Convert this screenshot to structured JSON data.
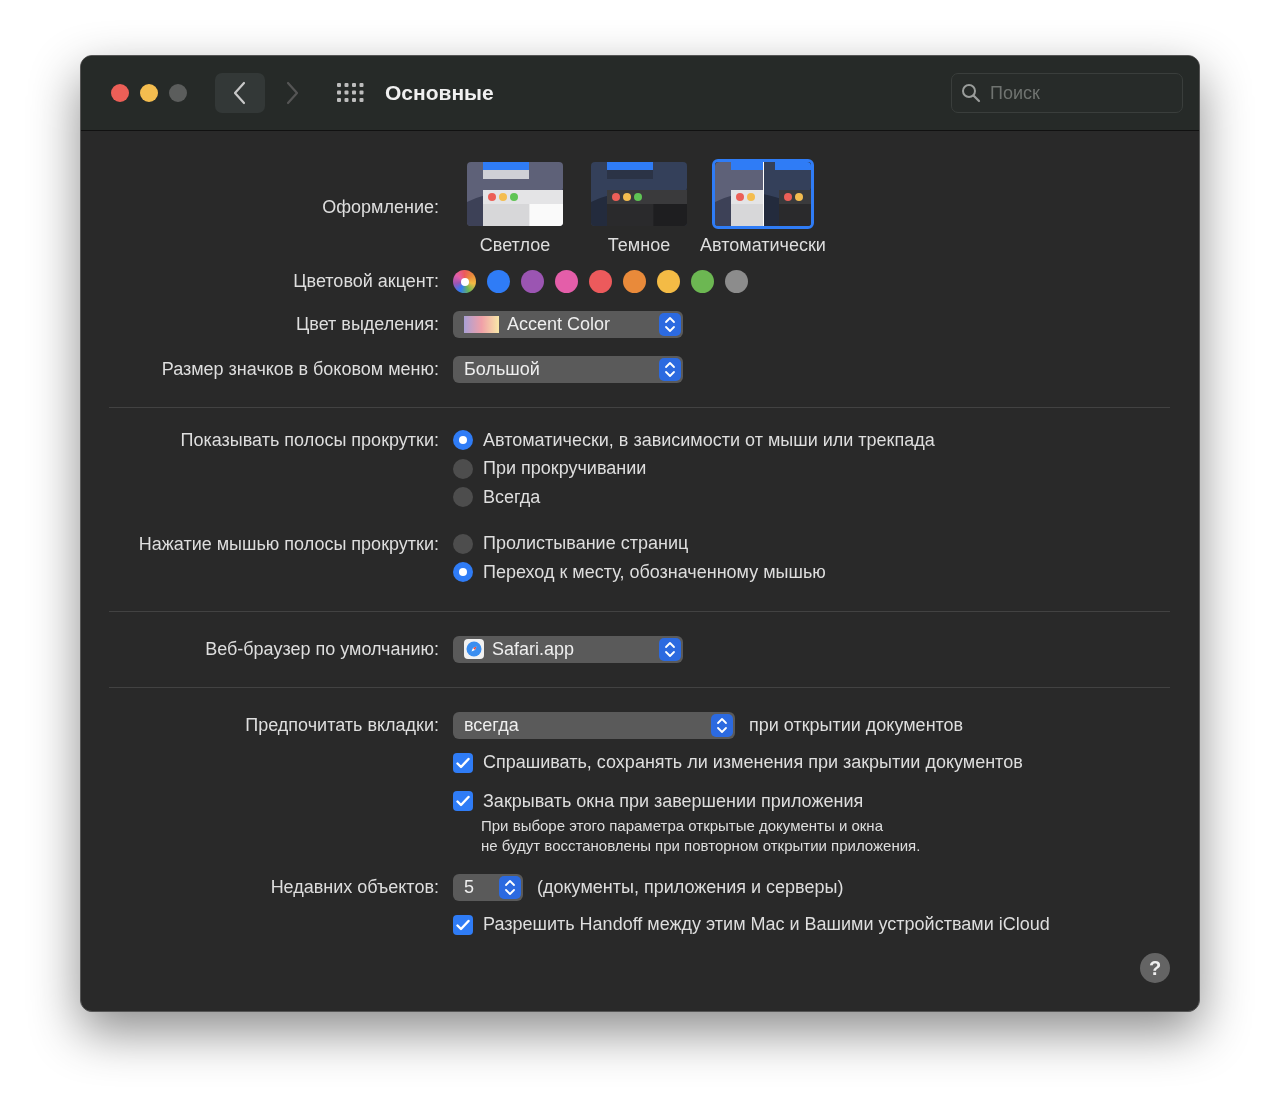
{
  "window": {
    "title": "Основные",
    "nav": {
      "back_enabled": true,
      "forward_enabled": false
    },
    "search": {
      "placeholder": "Поиск"
    }
  },
  "appearance": {
    "label": "Оформление:",
    "options": [
      {
        "kind": "light",
        "label": "Светлое",
        "selected": false
      },
      {
        "kind": "dark",
        "label": "Темное",
        "selected": false
      },
      {
        "kind": "auto",
        "label": "Автоматически",
        "selected": true
      }
    ]
  },
  "accent": {
    "label": "Цветовой акцент:",
    "colors": [
      {
        "kind": "multicolor",
        "selected": true
      },
      {
        "kind": "solid",
        "color": "#2f7cf6",
        "selected": false
      },
      {
        "kind": "solid",
        "color": "#9b55b2",
        "selected": false
      },
      {
        "kind": "solid",
        "color": "#e45ea9",
        "selected": false
      },
      {
        "kind": "solid",
        "color": "#ec5a5c",
        "selected": false
      },
      {
        "kind": "solid",
        "color": "#e98a3a",
        "selected": false
      },
      {
        "kind": "solid",
        "color": "#f4bb45",
        "selected": false
      },
      {
        "kind": "solid",
        "color": "#6cb752",
        "selected": false
      },
      {
        "kind": "solid",
        "color": "#8c8c8c",
        "selected": false
      }
    ]
  },
  "highlight_color": {
    "label": "Цвет выделения:",
    "value": "Accent Color"
  },
  "sidebar_icon_size": {
    "label": "Размер значков в боковом меню:",
    "value": "Большой"
  },
  "show_scroll_bars": {
    "label": "Показывать полосы прокрутки:",
    "options": [
      {
        "label": "Автоматически, в зависимости от мыши или трекпада",
        "selected": true
      },
      {
        "label": "При прокручивании",
        "selected": false
      },
      {
        "label": "Всегда",
        "selected": false
      }
    ]
  },
  "scroll_bar_click": {
    "label": "Нажатие мышью полосы прокрутки:",
    "options": [
      {
        "label": "Пролистывание страниц",
        "selected": false
      },
      {
        "label": "Переход к месту, обозначенному мышью",
        "selected": true
      }
    ]
  },
  "default_browser": {
    "label": "Веб-браузер по умолчанию:",
    "value": "Safari.app"
  },
  "prefer_tabs": {
    "label": "Предпочитать вкладки:",
    "value": "всегда",
    "suffix": "при открытии документов"
  },
  "ask_save": {
    "label": "Спрашивать, сохранять ли изменения при закрытии документов",
    "checked": true
  },
  "close_windows": {
    "label": "Закрывать окна при завершении приложения",
    "checked": true,
    "note_lines": [
      "При выборе этого параметра открытые документы и окна",
      "не будут восстановлены при повторном открытии приложения."
    ]
  },
  "recent_items": {
    "label": "Недавних объектов:",
    "value": "5",
    "suffix": "(документы, приложения и серверы)"
  },
  "handoff": {
    "label": "Разрешить Handoff между этим Mac и Вашими устройствами iCloud",
    "checked": true
  },
  "help": {
    "text": "?"
  }
}
